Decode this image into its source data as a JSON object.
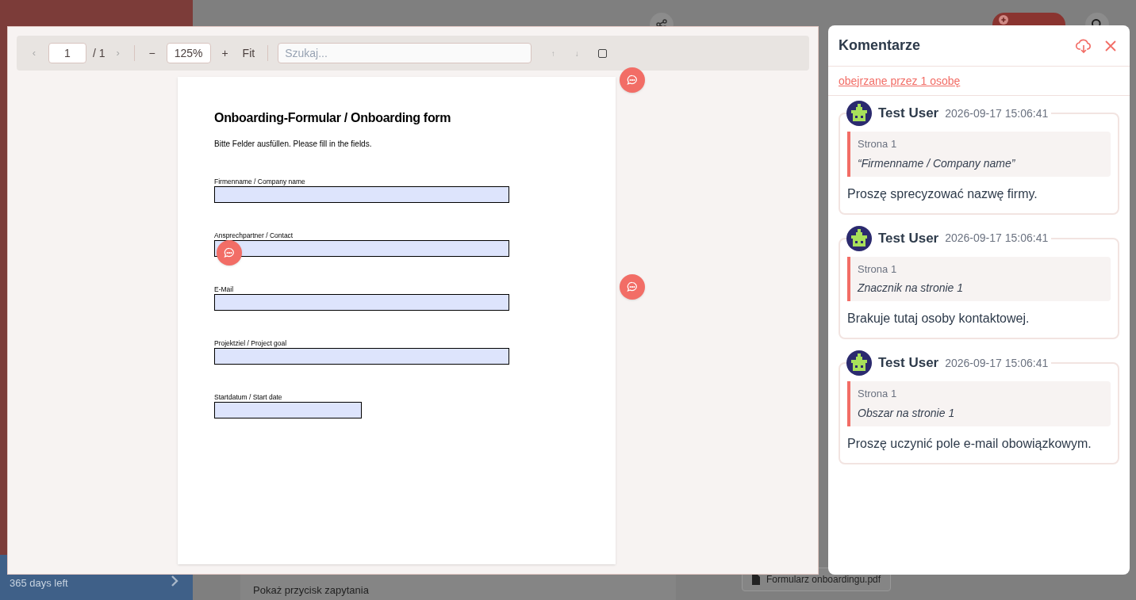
{
  "background": {
    "trial": "365 days left",
    "attachment": "Formularz onboardingu.pdf",
    "option": "Pokaż przycisk zapytania"
  },
  "viewer": {
    "toolbar": {
      "prev": "‹",
      "page": "1",
      "page_count": "/ 1",
      "next": "›",
      "zoom_out": "−",
      "zoom": "125%",
      "zoom_in": "+",
      "fit": "Fit",
      "search_placeholder": "Szukaj...",
      "up": "↑",
      "down": "↓",
      "checked": false
    },
    "document": {
      "title": "Onboarding-Formular / Onboarding form",
      "intro": "Bitte Felder ausfüllen. Please fill in the fields.",
      "marker": true,
      "fields": [
        {
          "label": "Firmenname / Company name",
          "kind": "full",
          "pin": false,
          "area": false
        },
        {
          "label": "Ansprechpartner / Contact",
          "kind": "full",
          "pin": true,
          "area": false
        },
        {
          "label": "E-Mail",
          "kind": "full",
          "pin": false,
          "area": true
        },
        {
          "label": "Projektziel / Project goal",
          "kind": "full",
          "pin": false,
          "area": false
        },
        {
          "label": "Startdatum / Start date",
          "kind": "short",
          "pin": false,
          "area": false
        }
      ]
    }
  },
  "comments_panel": {
    "title": "Komentarze",
    "viewed_link": "obejrzane przez 1 osobę",
    "comments": [
      {
        "author": "Test User",
        "time": "2026-09-17 15:06:41",
        "page": "Strona 1",
        "quote": "“Firmenname / Company name”",
        "body": "Proszę sprecyzować nazwę firmy."
      },
      {
        "author": "Test User",
        "time": "2026-09-17 15:06:41",
        "page": "Strona 1",
        "quote": "Znacznik na stronie 1",
        "body": "Brakuje tutaj osoby kontaktowej."
      },
      {
        "author": "Test User",
        "time": "2026-09-17 15:06:41",
        "page": "Strona 1",
        "quote": "Obszar na stronie 1",
        "body": "Proszę uczynić pole e-mail obowiązkowym."
      }
    ]
  }
}
